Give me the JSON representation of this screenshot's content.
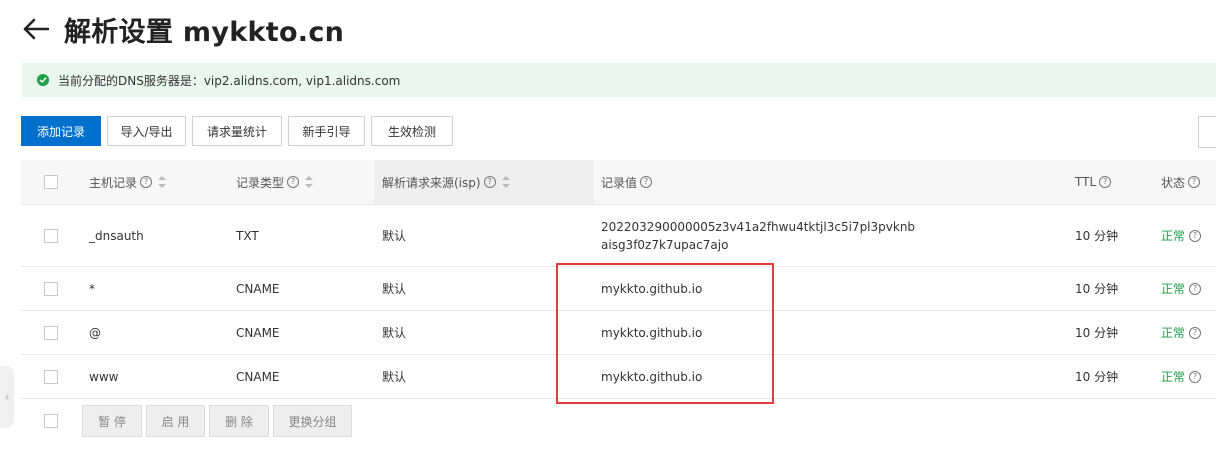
{
  "header": {
    "title": "解析设置 mykkto.cn"
  },
  "notice": {
    "text": "当前分配的DNS服务器是：vip2.alidns.com, vip1.alidns.com"
  },
  "toolbar": {
    "add": "添加记录",
    "import_export": "导入/导出",
    "stats": "请求量统计",
    "guide": "新手引导",
    "check": "生效检测"
  },
  "table": {
    "headers": {
      "host": "主机记录",
      "type": "记录类型",
      "isp": "解析请求来源(isp)",
      "value": "记录值",
      "ttl": "TTL",
      "status": "状态"
    },
    "rows": [
      {
        "host": "_dnsauth",
        "type": "TXT",
        "isp": "默认",
        "value_line1": "202203290000005z3v41a2fhwu4tktjl3c5i7pl3pvknb",
        "value_line2": "aisg3f0z7k7upac7ajo",
        "ttl": "10 分钟",
        "status": "正常"
      },
      {
        "host": "*",
        "type": "CNAME",
        "isp": "默认",
        "value": "mykkto.github.io",
        "ttl": "10 分钟",
        "status": "正常"
      },
      {
        "host": "@",
        "type": "CNAME",
        "isp": "默认",
        "value": "mykkto.github.io",
        "ttl": "10 分钟",
        "status": "正常"
      },
      {
        "host": "www",
        "type": "CNAME",
        "isp": "默认",
        "value": "mykkto.github.io",
        "ttl": "10 分钟",
        "status": "正常"
      }
    ]
  },
  "footer": {
    "pause": "暂 停",
    "enable": "启 用",
    "delete": "删 除",
    "group": "更换分组"
  },
  "colors": {
    "primary": "#0070cc",
    "success": "#1e9e48",
    "highlight": "#e23c3c",
    "notice_bg": "#e9f7ef"
  }
}
